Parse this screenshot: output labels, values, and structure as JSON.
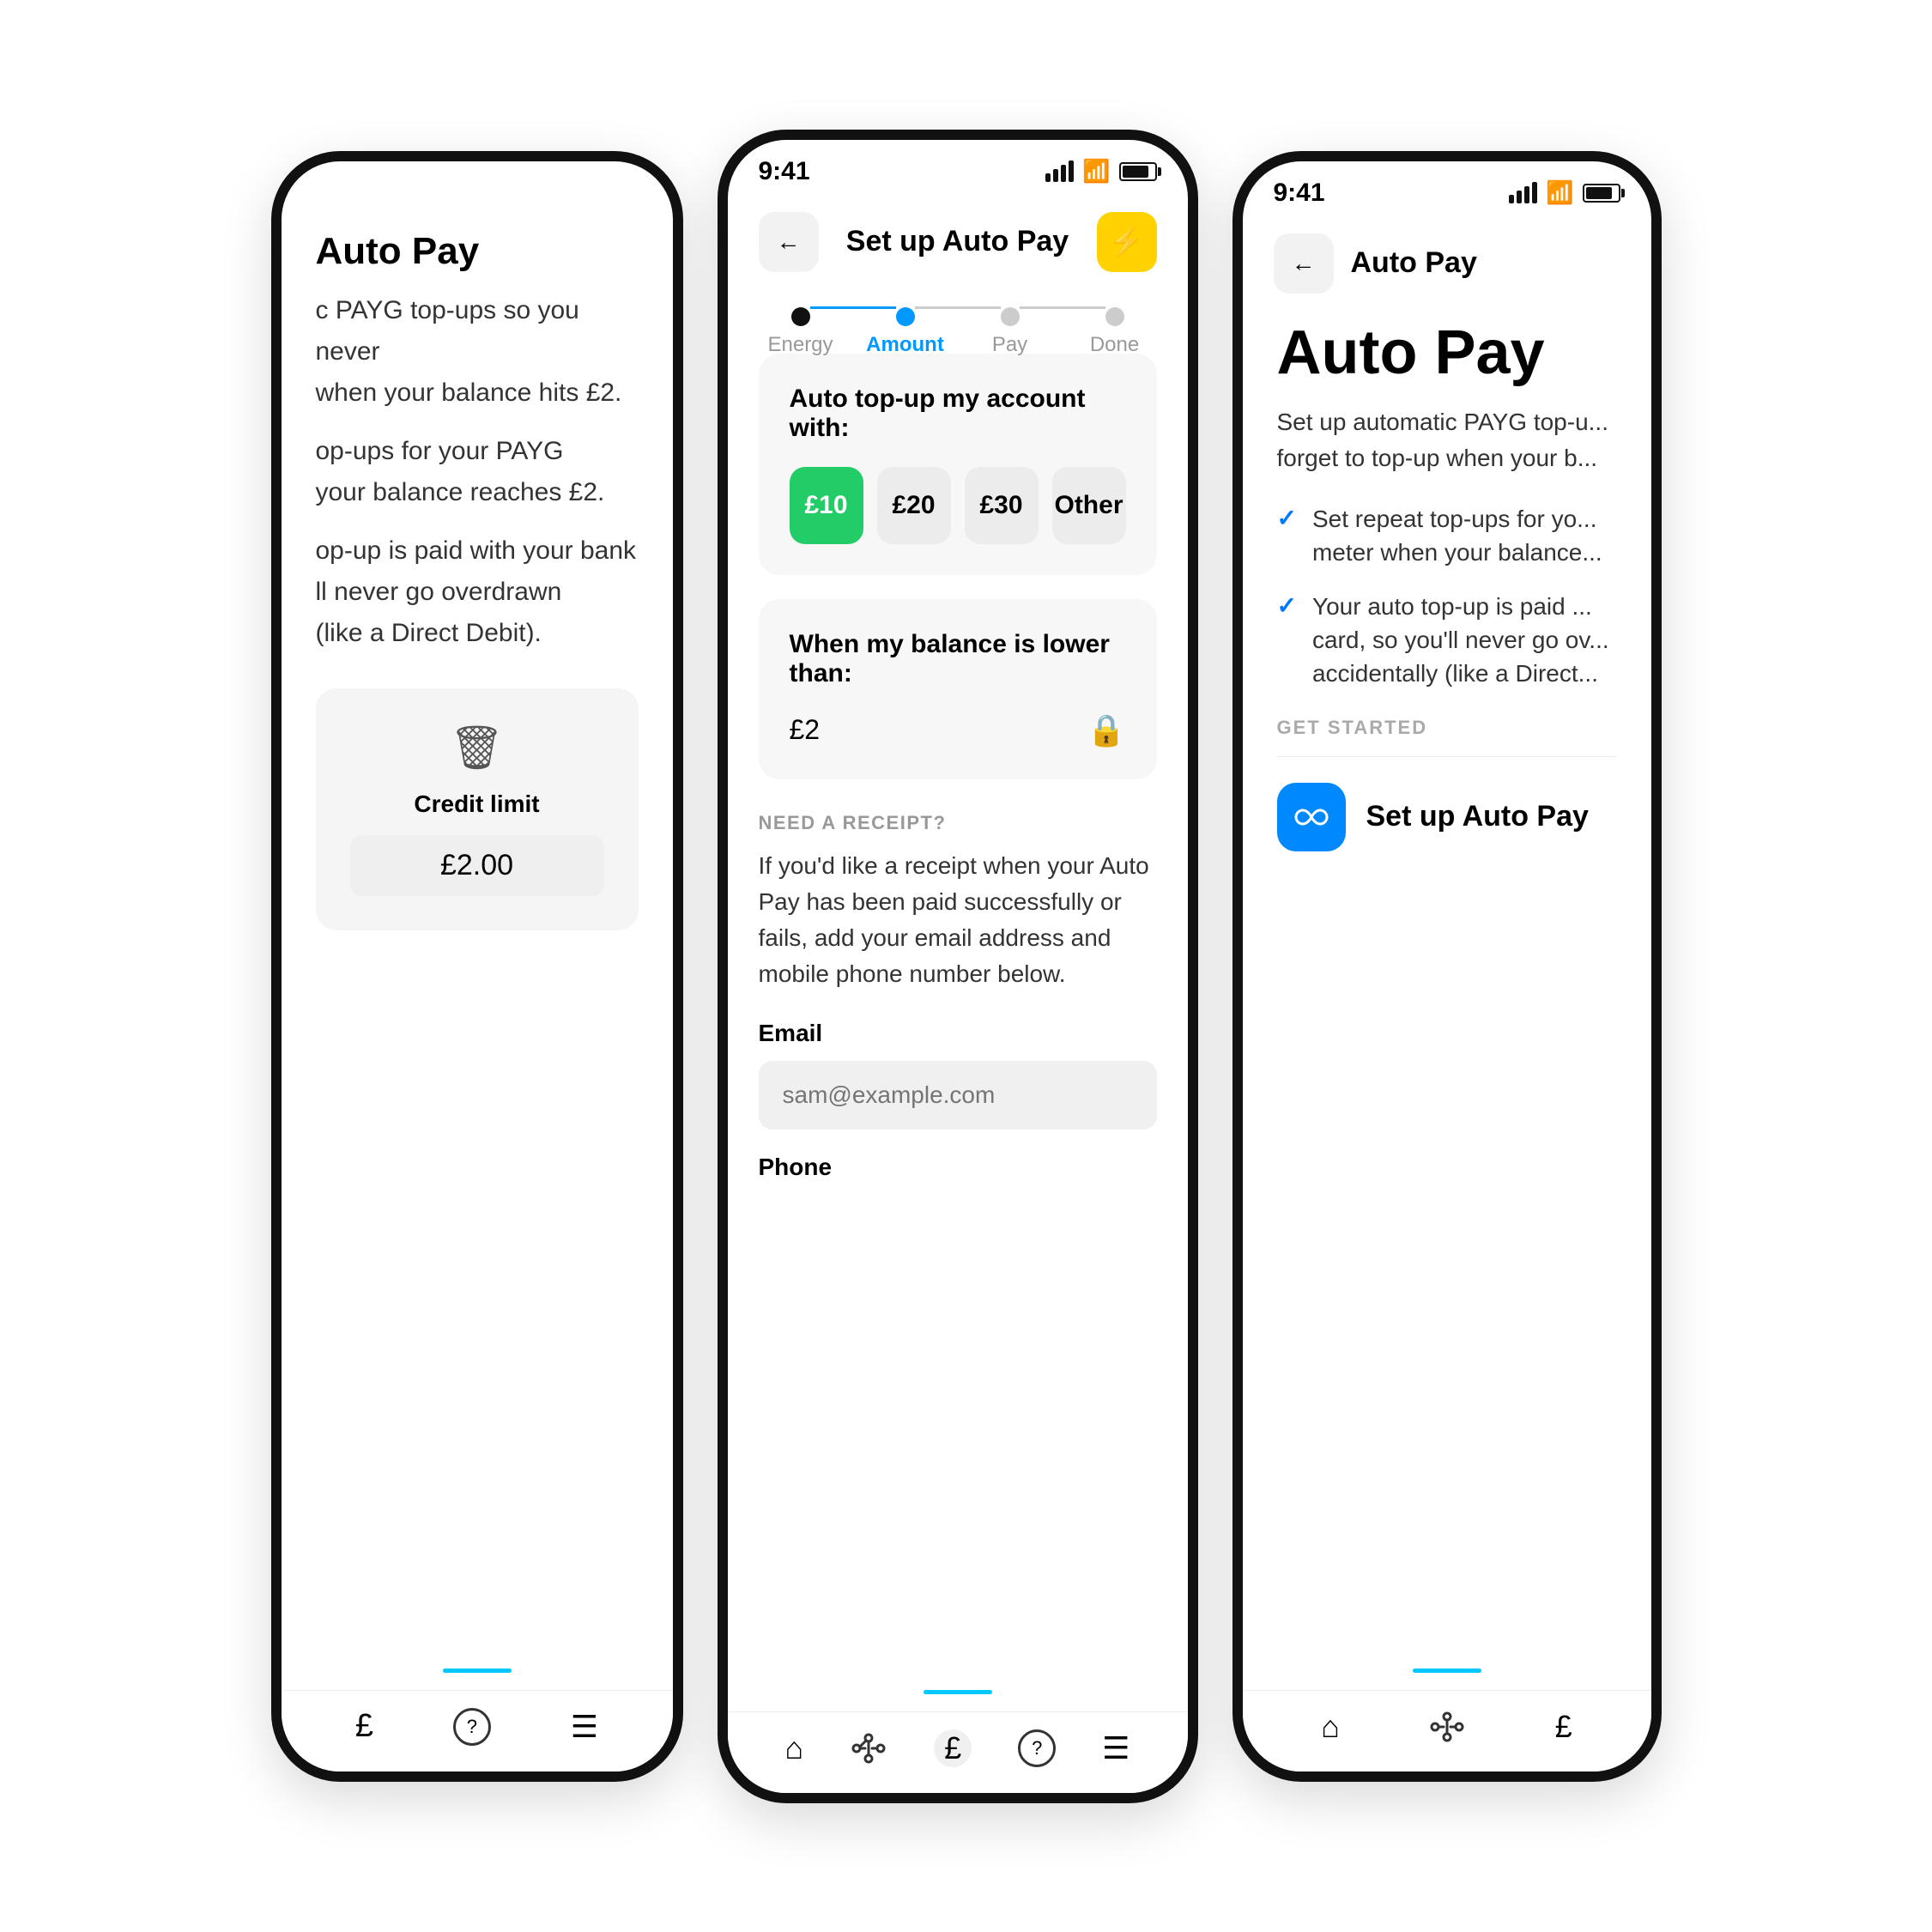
{
  "left_phone": {
    "title": "Auto Pay",
    "desc1": "c PAYG top-ups so you never when your balance hits £2.",
    "desc2": "op-ups for your PAYG your balance reaches £2.",
    "desc3": "op-up is paid with your bank ll never go overdrawn (like a Direct Debit).",
    "credit_label": "Credit limit",
    "credit_amount": "£2.00",
    "bottom_nav": [
      "£",
      "?",
      "≡"
    ]
  },
  "center_phone": {
    "time": "9:41",
    "title": "Set up Auto Pay",
    "back_label": "←",
    "steps": [
      {
        "label": "Energy",
        "state": "done"
      },
      {
        "label": "Amount",
        "state": "active"
      },
      {
        "label": "Pay",
        "state": "inactive"
      },
      {
        "label": "Done",
        "state": "inactive"
      }
    ],
    "topup_section": {
      "title": "Auto top-up my account with:",
      "amounts": [
        {
          "value": "£10",
          "selected": true
        },
        {
          "value": "£20",
          "selected": false
        },
        {
          "value": "£30",
          "selected": false
        },
        {
          "value": "Other",
          "selected": false
        }
      ]
    },
    "balance_section": {
      "title": "When my balance is lower than:",
      "amount": "£2"
    },
    "receipt_section": {
      "label": "NEED A RECEIPT?",
      "desc": "If you'd like a receipt when your Auto Pay has been paid successfully or fails, add your email address and mobile phone number below.",
      "email_label": "Email",
      "email_placeholder": "sam@example.com",
      "phone_label": "Phone"
    },
    "bottom_nav": [
      "home",
      "network",
      "pound",
      "help",
      "menu"
    ]
  },
  "right_phone": {
    "time": "9:41",
    "back_label": "←",
    "nav_title": "Auto Pay",
    "main_title": "Auto Pay",
    "desc": "Set up automatic PAYG top-u... forget to top-up when your b...",
    "checklist": [
      "Set repeat top-ups for yo... meter when your balance...",
      "Your auto top-up is paid ... card, so you'll never go ov... accidentally (like a Direct..."
    ],
    "get_started_label": "GET STARTED",
    "setup_btn_label": "Set up Auto Pay",
    "bottom_nav": [
      "home",
      "network",
      "pound"
    ]
  },
  "colors": {
    "accent_blue": "#0088ff",
    "accent_green": "#22cc66",
    "accent_yellow": "#ffd200",
    "accent_cyan": "#00c8ff",
    "text_primary": "#111111",
    "text_secondary": "#999999",
    "bg_card": "#f7f7f7"
  }
}
